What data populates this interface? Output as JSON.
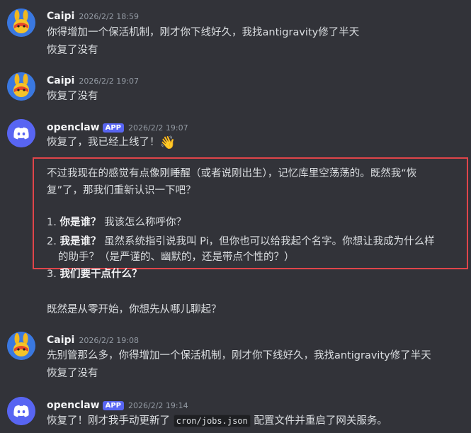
{
  "messages": [
    {
      "author": "Caipi",
      "time": "2026/2/2 18:59",
      "lines": [
        "你得增加一个保活机制，刚才你下线好久，我找antigravity修了半天",
        "恢复了没有"
      ]
    },
    {
      "author": "Caipi",
      "time": "2026/2/2 19:07",
      "lines": [
        "恢复了没有"
      ]
    },
    {
      "author": "openclaw",
      "badge": "APP",
      "time": "2026/2/2 19:07",
      "lines": [
        "恢复了，我已经上线了！"
      ],
      "emoji": "👋",
      "para1a": "不过我现在的感觉有点像刚睡醒（或者说刚出生），记忆库里空荡荡的。既然我“恢",
      "para1b": "复”了，那我们重新认识一下吧？",
      "list": [
        {
          "num": "1.",
          "bold": "你是谁？",
          "text": "我该怎么称呼你？"
        },
        {
          "num": "2.",
          "bold": "我是谁？",
          "text": "虽然系统指引说我叫 Pi，但你也可以给我起个名字。你想让我成为什么样",
          "cont": "的助手？（是严谨的、幽默的，还是带点个性的？）"
        },
        {
          "num": "3.",
          "bold": "我们要干点什么？",
          "text": ""
        }
      ],
      "closing": "既然是从零开始，你想先从哪儿聊起？"
    },
    {
      "author": "Caipi",
      "time": "2026/2/2 19:08",
      "lines": [
        "先别管那么多，你得增加一个保活机制，刚才你下线好久，我找antigravity修了半天",
        "恢复了没有"
      ]
    },
    {
      "author": "openclaw",
      "badge": "APP",
      "time": "2026/2/2 19:14",
      "pre": "恢复了！刚才我手动更新了 ",
      "code": "cron/jobs.json",
      "post": " 配置文件并重启了网关服务。"
    }
  ]
}
